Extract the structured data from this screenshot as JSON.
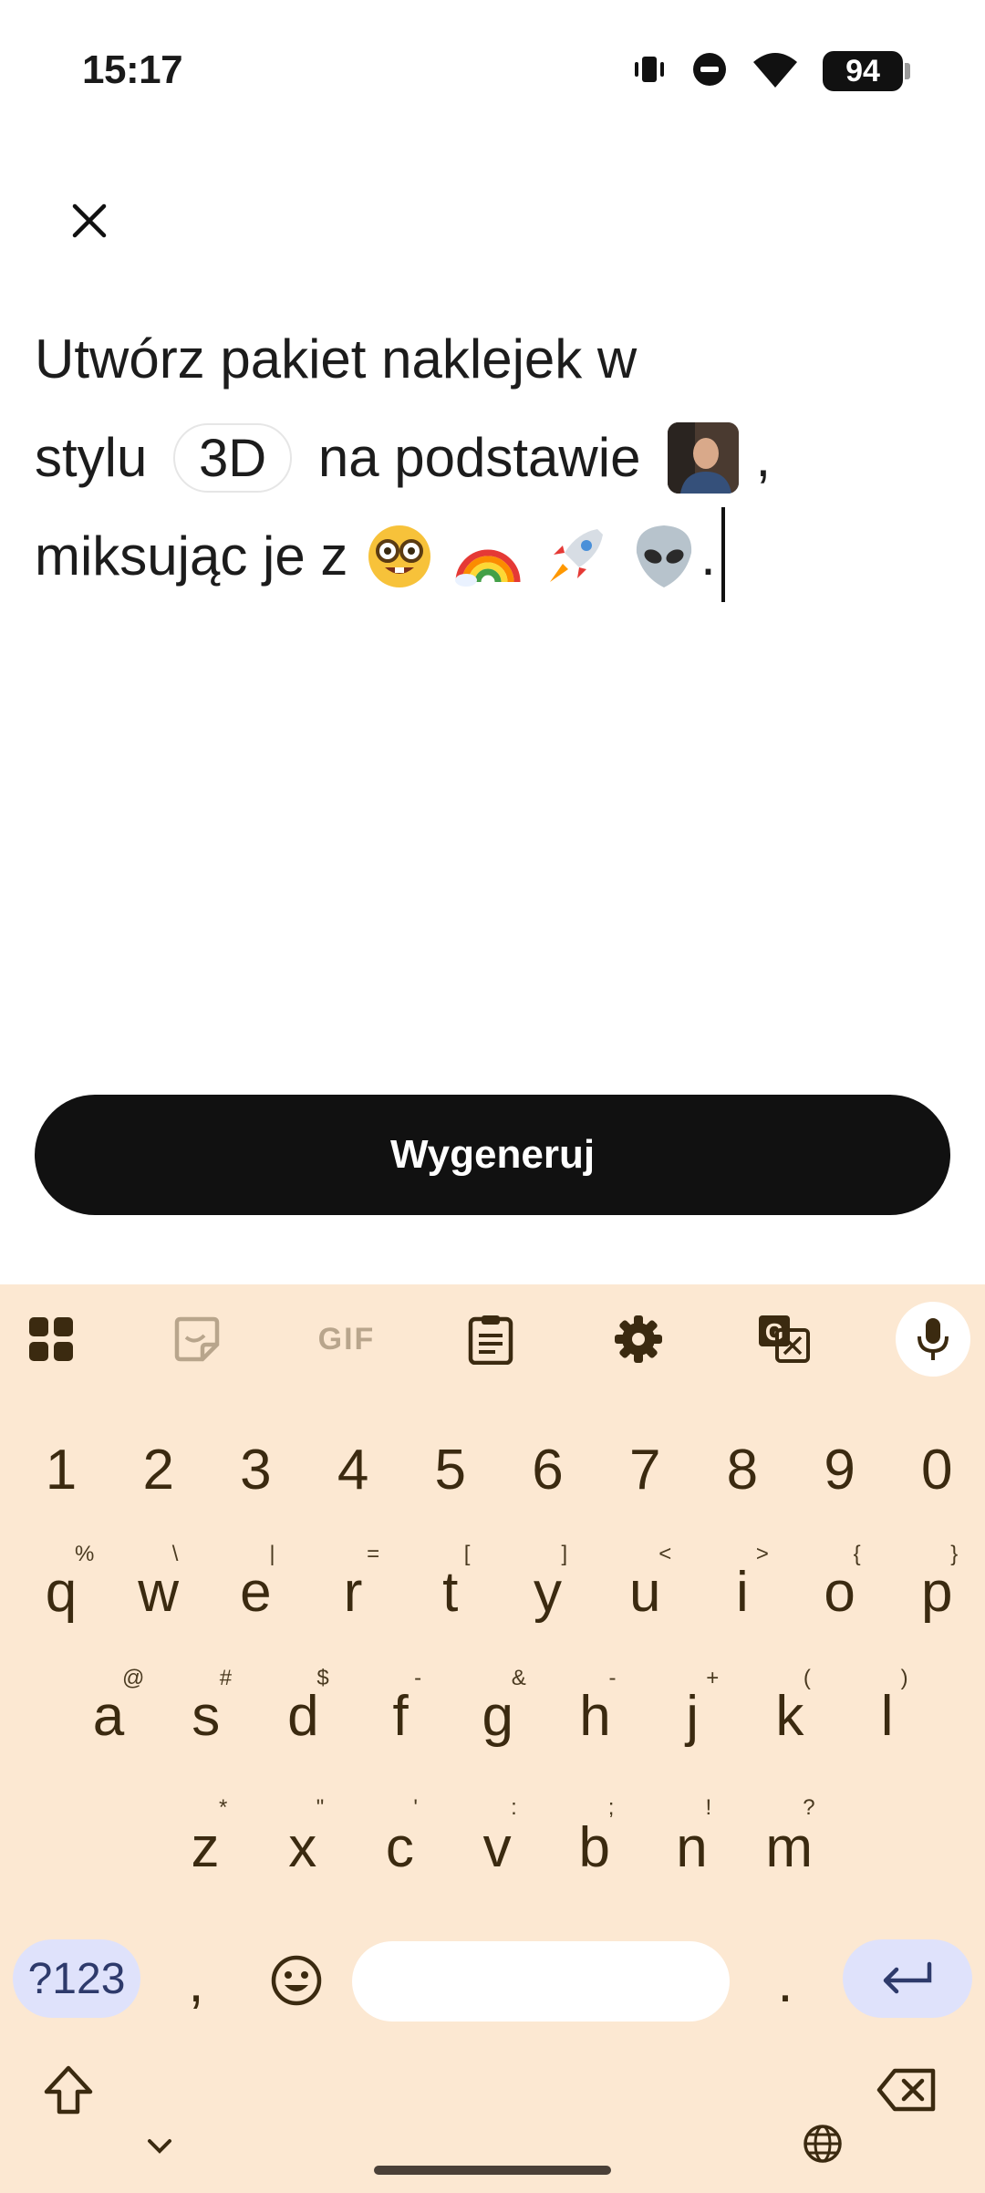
{
  "status_bar": {
    "time": "15:17",
    "battery": "94"
  },
  "prompt": {
    "line1": "Utwórz pakiet naklejek w",
    "line2_pre": "stylu",
    "style_chip": "3D",
    "line2_post": "na podstawie",
    "line2_comma": ",",
    "line3_pre": "miksując je z",
    "line3_end": "."
  },
  "generate_button": {
    "label": "Wygeneruj"
  },
  "keyboard": {
    "toolbar": {
      "gif_label": "GIF"
    },
    "number_row": [
      "1",
      "2",
      "3",
      "4",
      "5",
      "6",
      "7",
      "8",
      "9",
      "0"
    ],
    "row1": [
      {
        "k": "q",
        "h": "%"
      },
      {
        "k": "w",
        "h": "\\"
      },
      {
        "k": "e",
        "h": "|"
      },
      {
        "k": "r",
        "h": "="
      },
      {
        "k": "t",
        "h": "["
      },
      {
        "k": "y",
        "h": "]"
      },
      {
        "k": "u",
        "h": "<"
      },
      {
        "k": "i",
        "h": ">"
      },
      {
        "k": "o",
        "h": "{"
      },
      {
        "k": "p",
        "h": "}"
      }
    ],
    "row2": [
      {
        "k": "a",
        "h": "@"
      },
      {
        "k": "s",
        "h": "#"
      },
      {
        "k": "d",
        "h": "$"
      },
      {
        "k": "f",
        "h": "-"
      },
      {
        "k": "g",
        "h": "&"
      },
      {
        "k": "h",
        "h": "-"
      },
      {
        "k": "j",
        "h": "+"
      },
      {
        "k": "k",
        "h": "("
      },
      {
        "k": "l",
        "h": ")"
      }
    ],
    "row3": [
      {
        "k": "z",
        "h": "*"
      },
      {
        "k": "x",
        "h": "\""
      },
      {
        "k": "c",
        "h": "'"
      },
      {
        "k": "v",
        "h": ":"
      },
      {
        "k": "b",
        "h": ";"
      },
      {
        "k": "n",
        "h": "!"
      },
      {
        "k": "m",
        "h": "?"
      }
    ],
    "symbols_label": "?123",
    "comma": ",",
    "period": "."
  },
  "icons": {
    "close": "close-icon",
    "apps": "apps-grid-icon",
    "sticker": "sticker-icon",
    "clipboard": "clipboard-icon",
    "settings": "gear-icon",
    "translate": "translate-icon",
    "mic": "microphone-icon",
    "shift": "shift-icon",
    "backspace": "backspace-icon",
    "emoji": "emoji-icon",
    "enter": "enter-icon",
    "collapse": "chevron-down-icon",
    "language": "globe-icon"
  },
  "colors": {
    "keyboard_bg": "#fce8d2",
    "key_text": "#3b2a10",
    "accent_key": "#dfe2fb",
    "button_bg": "#111111"
  }
}
